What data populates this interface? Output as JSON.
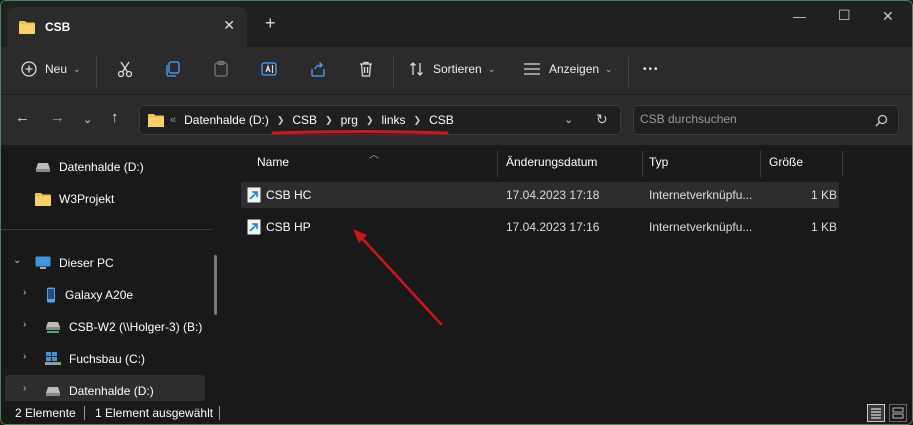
{
  "window": {
    "tab_title": "CSB",
    "new_tab": "+"
  },
  "toolbar": {
    "new_label": "Neu",
    "sort_label": "Sortieren",
    "view_label": "Anzeigen",
    "more": "•••"
  },
  "address": {
    "overflow": "«",
    "crumbs": [
      "Datenhalde (D:)",
      "CSB",
      "prg",
      "links",
      "CSB"
    ]
  },
  "search": {
    "placeholder": "CSB durchsuchen"
  },
  "sidebar": {
    "items": [
      {
        "label": "Datenhalde (D:)"
      },
      {
        "label": "W3Projekt"
      },
      {
        "label": "Dieser PC"
      },
      {
        "label": "Galaxy A20e"
      },
      {
        "label": "CSB-W2 (\\\\Holger-3) (B:)"
      },
      {
        "label": "Fuchsbau (C:)"
      },
      {
        "label": "Datenhalde (D:)"
      }
    ]
  },
  "list": {
    "headers": {
      "name": "Name",
      "date": "Änderungsdatum",
      "type": "Typ",
      "size": "Größe"
    },
    "rows": [
      {
        "name": "CSB HC",
        "date": "17.04.2023 17:18",
        "type": "Internetverknüpfu...",
        "size": "1 KB"
      },
      {
        "name": "CSB HP",
        "date": "17.04.2023 17:16",
        "type": "Internetverknüpfu...",
        "size": "1 KB"
      }
    ]
  },
  "status": {
    "count": "2 Elemente",
    "selected": "1 Element ausgewählt"
  },
  "colors": {
    "accent_border": "#3a8a5a",
    "annotation_red": "#d0141e",
    "folder_yellow": "#f4c245"
  }
}
